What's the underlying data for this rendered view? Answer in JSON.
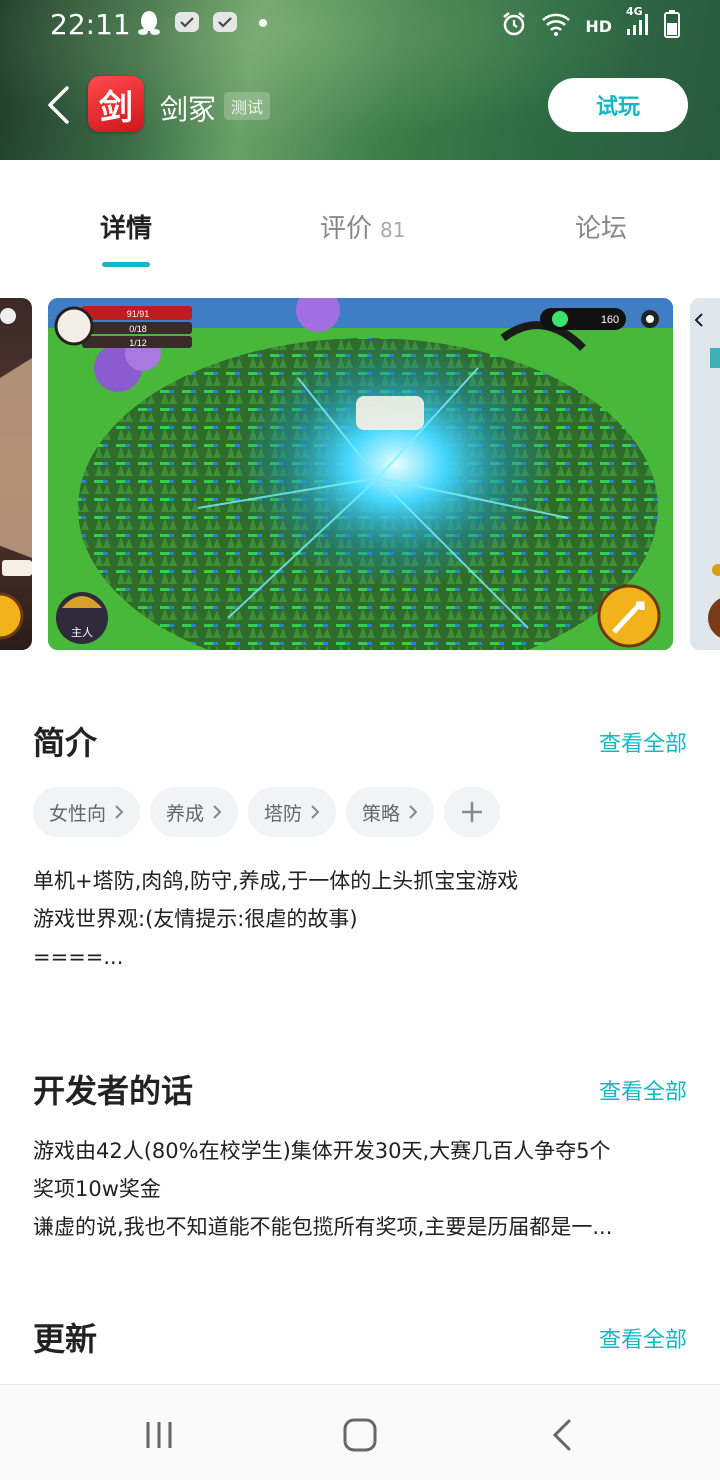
{
  "status_bar": {
    "time": "22:11",
    "network": "HD",
    "network_type": "4G",
    "icons_left": [
      "qq-icon",
      "chat-icon",
      "chat-icon",
      "dot-icon"
    ],
    "icons_right": [
      "alarm-icon",
      "wifi-icon",
      "signal-icon",
      "battery-icon"
    ]
  },
  "header": {
    "app_icon_char": "剑",
    "app_name": "剑冢",
    "badge": "测试",
    "try_button": "试玩",
    "bg_color": "#3c7d4a"
  },
  "tabs": [
    {
      "label": "详情",
      "count": "",
      "active": true
    },
    {
      "label": "评价",
      "count": "81",
      "active": false
    },
    {
      "label": "论坛",
      "count": "",
      "active": false
    }
  ],
  "accent_color": "#14b8c4",
  "gallery": {
    "main_hud": {
      "hp": "91/91",
      "stat2": "0/18",
      "stat3": "1/12",
      "gems": "160",
      "hero_label": "主人"
    }
  },
  "intro": {
    "title": "简介",
    "see_all": "查看全部",
    "tags": [
      "女性向",
      "养成",
      "塔防",
      "策略"
    ],
    "text_lines": [
      "单机+塔防,肉鸽,防守,养成,于一体的上头抓宝宝游戏",
      "游戏世界观:(友情提示:很虐的故事)",
      "====..."
    ]
  },
  "developer": {
    "title": "开发者的话",
    "see_all": "查看全部",
    "text_lines": [
      "游戏由42人(80%在校学生)集体开发30天,大赛几百人争夺5个",
      "奖项10w奖金",
      "谦虚的说,我也不知道能不能包揽所有奖项,主要是历届都是一..."
    ]
  },
  "update": {
    "title": "更新",
    "see_all": "查看全部"
  },
  "navbar": {
    "buttons": [
      "recents-icon",
      "home-icon",
      "back-icon"
    ]
  }
}
